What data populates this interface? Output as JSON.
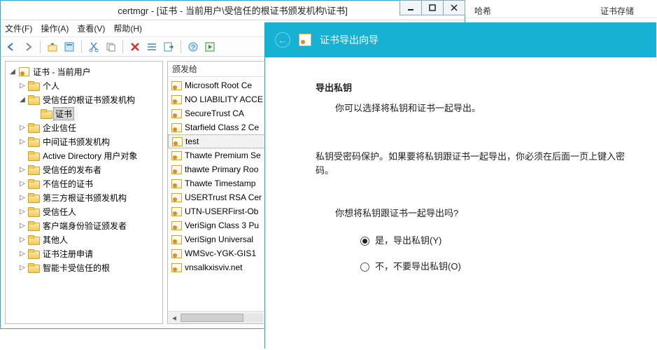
{
  "bg_columns": {
    "col1": "哈希",
    "col2": "证书存储"
  },
  "window": {
    "title": "certmgr - [证书 - 当前用户\\受信任的根证书颁发机构\\证书]"
  },
  "menu": {
    "file": "文件(F)",
    "action": "操作(A)",
    "view": "查看(V)",
    "help": "帮助(H)"
  },
  "tree": {
    "root": "证书 - 当前用户",
    "items": [
      {
        "label": "个人",
        "expander": "▷"
      },
      {
        "label": "受信任的根证书颁发机构",
        "expander": "◢",
        "expanded": true,
        "children": [
          {
            "label": "证书",
            "selected": true
          }
        ]
      },
      {
        "label": "企业信任",
        "expander": "▷"
      },
      {
        "label": "中间证书颁发机构",
        "expander": "▷"
      },
      {
        "label": "Active Directory 用户对象",
        "expander": ""
      },
      {
        "label": "受信任的发布者",
        "expander": "▷"
      },
      {
        "label": "不信任的证书",
        "expander": "▷"
      },
      {
        "label": "第三方根证书颁发机构",
        "expander": "▷"
      },
      {
        "label": "受信任人",
        "expander": "▷"
      },
      {
        "label": "客户端身份验证颁发者",
        "expander": "▷"
      },
      {
        "label": "其他人",
        "expander": "▷"
      },
      {
        "label": "证书注册申请",
        "expander": "▷"
      },
      {
        "label": "智能卡受信任的根",
        "expander": "▷"
      }
    ]
  },
  "list": {
    "header": "颁发给",
    "rows": [
      "Microsoft Root Ce",
      "NO LIABILITY ACCE",
      "SecureTrust CA",
      "Starfield Class 2 Ce",
      "test",
      "Thawte Premium Se",
      "thawte Primary Roo",
      "Thawte Timestamp",
      "USERTrust RSA Cer",
      "UTN-USERFirst-Ob",
      "VeriSign Class 3 Pu",
      "VeriSign Universal",
      "WMSvc-YGK-GIS1",
      "vnsalkxisviv.net"
    ],
    "selected_index": 4
  },
  "wizard": {
    "title": "证书导出向导",
    "section_title": "导出私钥",
    "hint": "你可以选择将私钥和证书一起导出。",
    "desc": "私钥受密码保护。如果要将私钥跟证书一起导出，你必须在后面一页上键入密码。",
    "question": "你想将私钥跟证书一起导出吗?",
    "radio_yes": "是，导出私钥(Y)",
    "radio_no": "不，不要导出私钥(O)"
  }
}
